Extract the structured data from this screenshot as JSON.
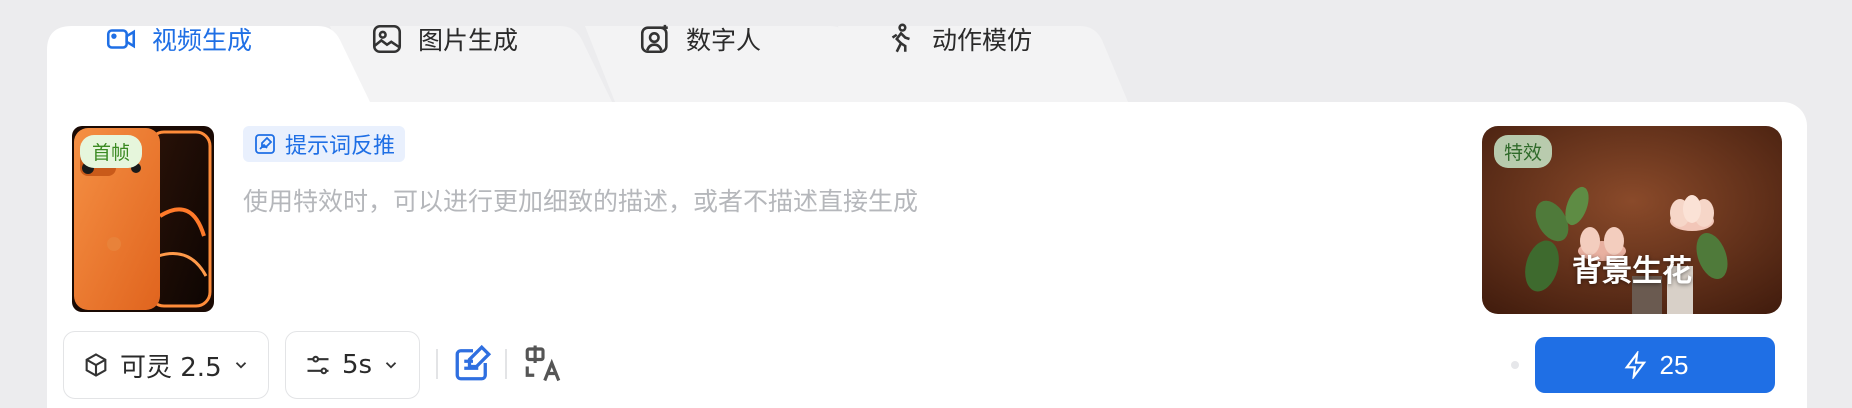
{
  "tabs": [
    {
      "label": "视频生成",
      "icon": "video-camera-icon",
      "active": true
    },
    {
      "label": "图片生成",
      "icon": "image-icon",
      "active": false
    },
    {
      "label": "数字人",
      "icon": "digital-human-icon",
      "active": false
    },
    {
      "label": "动作模仿",
      "icon": "running-person-icon",
      "active": false
    }
  ],
  "frame": {
    "badge": "首帧"
  },
  "prompt": {
    "reverse_label": "提示词反推",
    "placeholder": "使用特效时，可以进行更加细致的描述，或者不描述直接生成",
    "value": ""
  },
  "effect": {
    "badge": "特效",
    "title": "背景生花"
  },
  "toolbar": {
    "model_label": "可灵 2.5",
    "duration_label": "5s",
    "generate_cost": "25"
  },
  "colors": {
    "accent": "#1f6fe5",
    "frame_badge_bg": "#e6f6dc"
  }
}
